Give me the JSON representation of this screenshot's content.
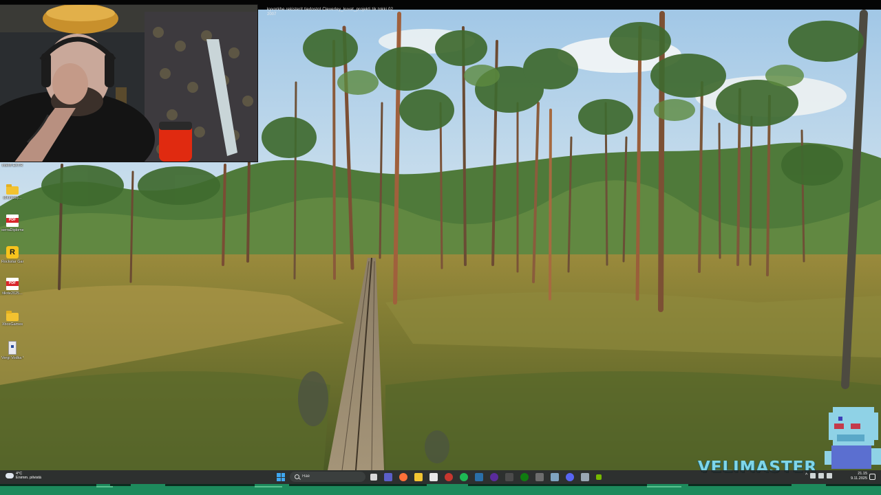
{
  "topbar": {
    "line1": "kyvorkhe rekisterit  tiedostot  Cleverley_kuvat_projekti  tik tokki 02  ",
    "line2": "2007"
  },
  "desktop_icons": [
    {
      "label": "Intel® EXTR",
      "icon": "app-icon"
    },
    {
      "label": "(6Ium30)...",
      "icon": "folder-icon"
    },
    {
      "label": "serraDiplomati/Matkat",
      "icon": "pdf-icon"
    },
    {
      "label": "Rockstar Games",
      "icon": "rockstar-icon"
    },
    {
      "label": "tiliote2025...",
      "icon": "pdf-icon"
    },
    {
      "label": "XboxGames",
      "icon": "folder-icon"
    },
    {
      "label": "Vergi Vodka Vain",
      "icon": "usb-drive-icon"
    }
  ],
  "overlay": {
    "logo_text": "VELIMASTER"
  },
  "taskbar": {
    "weather_temp": "4°C",
    "weather_desc": "Enimm. pilvistä",
    "search_placeholder": "Hae",
    "apps": [
      "task-view",
      "teams",
      "firefox",
      "file-explorer",
      "store",
      "chrome",
      "spotify",
      "steam",
      "obs",
      "calculator",
      "xbox",
      "epic",
      "settings",
      "discord",
      "photos",
      "nvidia"
    ],
    "clock_time": "21.15",
    "clock_date": "9.11.2025"
  },
  "colors": {
    "taskbar_bg": "#1c201e",
    "accent": "#3fa7f0",
    "logo": "#7fd6e8",
    "strip": "#1d8a5c"
  }
}
